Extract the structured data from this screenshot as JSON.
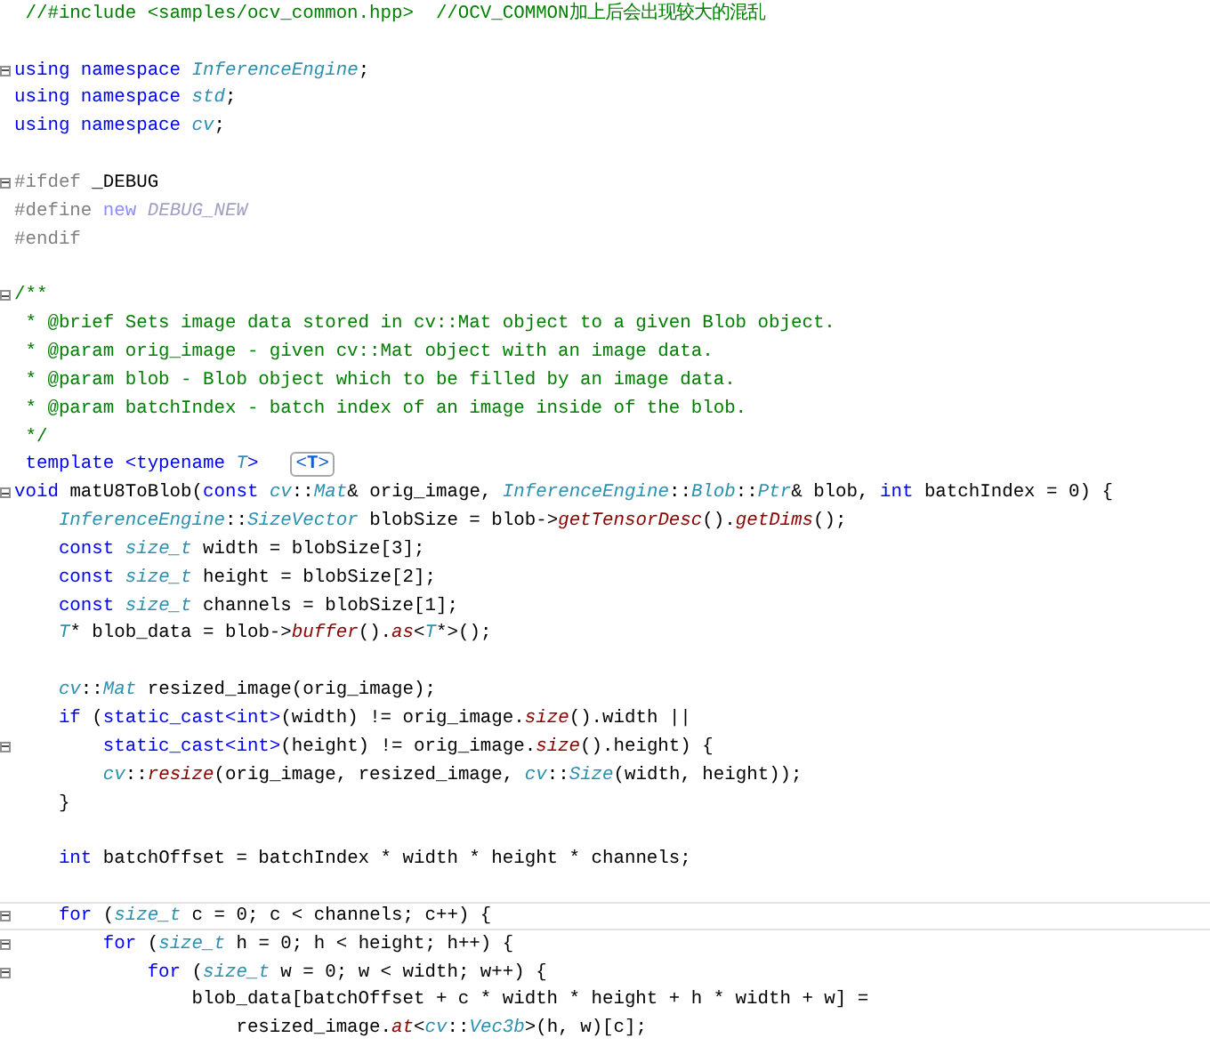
{
  "editor": {
    "lines": [
      {
        "fold": false,
        "current": false,
        "t": [
          {
            "kind": "c",
            "text": " //#include <samples/ocv_common.hpp>  //OCV_COMMON加上后会出现较大的混乱"
          }
        ]
      },
      {
        "fold": false,
        "current": false
      },
      {
        "fold": true,
        "current": false,
        "t": [
          {
            "kind": "kw",
            "text": "using namespace "
          },
          {
            "kind": "ty",
            "text": "InferenceEngine"
          },
          {
            "kind": "p",
            "text": ";"
          }
        ]
      },
      {
        "fold": false,
        "current": false,
        "t": [
          {
            "kind": "kw",
            "text": "using namespace "
          },
          {
            "kind": "ty",
            "text": "std"
          },
          {
            "kind": "p",
            "text": ";"
          }
        ]
      },
      {
        "fold": false,
        "current": false,
        "t": [
          {
            "kind": "kw",
            "text": "using namespace "
          },
          {
            "kind": "ty",
            "text": "cv"
          },
          {
            "kind": "p",
            "text": ";"
          }
        ]
      },
      {
        "fold": false,
        "current": false
      },
      {
        "fold": true,
        "current": false,
        "t": [
          {
            "kind": "pp",
            "text": "#ifdef"
          },
          {
            "kind": "p",
            "text": " _DEBUG"
          }
        ]
      },
      {
        "fold": false,
        "current": false,
        "t": [
          {
            "kind": "pp",
            "text": "#define "
          },
          {
            "kind": "pk",
            "text": "new "
          },
          {
            "kind": "pm",
            "text": "DEBUG_NEW"
          }
        ]
      },
      {
        "fold": false,
        "current": false,
        "t": [
          {
            "kind": "pp",
            "text": "#endif"
          }
        ]
      },
      {
        "fold": false,
        "current": false
      },
      {
        "fold": true,
        "current": false,
        "t": [
          {
            "kind": "c",
            "text": "/**"
          }
        ]
      },
      {
        "fold": false,
        "current": false,
        "t": [
          {
            "kind": "c",
            "text": " * @brief Sets image data stored in cv::Mat object to a given Blob object."
          }
        ]
      },
      {
        "fold": false,
        "current": false,
        "t": [
          {
            "kind": "c",
            "text": " * @param orig_image - given cv::Mat object with an image data."
          }
        ]
      },
      {
        "fold": false,
        "current": false,
        "t": [
          {
            "kind": "c",
            "text": " * @param blob - Blob object which to be filled by an image data."
          }
        ]
      },
      {
        "fold": false,
        "current": false,
        "t": [
          {
            "kind": "c",
            "text": " * @param batchIndex - batch index of an image inside of the blob."
          }
        ]
      },
      {
        "fold": false,
        "current": false,
        "t": [
          {
            "kind": "c",
            "text": " */"
          }
        ]
      },
      {
        "fold": false,
        "current": false,
        "t": [
          {
            "kind": "kw",
            "text": " template <typename "
          },
          {
            "kind": "ty",
            "text": "T"
          },
          {
            "kind": "kw",
            "text": ">"
          }
        ],
        "hint": "<**T**>"
      },
      {
        "fold": true,
        "current": false,
        "t": [
          {
            "kind": "kw",
            "text": "void"
          },
          {
            "kind": "p",
            "text": " matU8ToBlob("
          },
          {
            "kind": "kw",
            "text": "const "
          },
          {
            "kind": "ty",
            "text": "cv"
          },
          {
            "kind": "p",
            "text": "::"
          },
          {
            "kind": "ty",
            "text": "Mat"
          },
          {
            "kind": "p",
            "text": "& orig_image, "
          },
          {
            "kind": "ty",
            "text": "InferenceEngine"
          },
          {
            "kind": "p",
            "text": "::"
          },
          {
            "kind": "ty",
            "text": "Blob"
          },
          {
            "kind": "p",
            "text": "::"
          },
          {
            "kind": "ty",
            "text": "Ptr"
          },
          {
            "kind": "p",
            "text": "& blob, "
          },
          {
            "kind": "kw",
            "text": "int"
          },
          {
            "kind": "p",
            "text": " batchIndex = 0) {"
          }
        ]
      },
      {
        "fold": false,
        "current": false,
        "t": [
          {
            "kind": "ty",
            "text": "    InferenceEngine"
          },
          {
            "kind": "p",
            "text": "::"
          },
          {
            "kind": "ty",
            "text": "SizeVector"
          },
          {
            "kind": "p",
            "text": " blobSize = blob->"
          },
          {
            "kind": "fn",
            "text": "getTensorDesc"
          },
          {
            "kind": "p",
            "text": "()."
          },
          {
            "kind": "fn",
            "text": "getDims"
          },
          {
            "kind": "p",
            "text": "();"
          }
        ]
      },
      {
        "fold": false,
        "current": false,
        "t": [
          {
            "kind": "kw",
            "text": "    const "
          },
          {
            "kind": "ty",
            "text": "size_t"
          },
          {
            "kind": "p",
            "text": " width = blobSize[3];"
          }
        ]
      },
      {
        "fold": false,
        "current": false,
        "t": [
          {
            "kind": "kw",
            "text": "    const "
          },
          {
            "kind": "ty",
            "text": "size_t"
          },
          {
            "kind": "p",
            "text": " height = blobSize[2];"
          }
        ]
      },
      {
        "fold": false,
        "current": false,
        "t": [
          {
            "kind": "kw",
            "text": "    const "
          },
          {
            "kind": "ty",
            "text": "size_t"
          },
          {
            "kind": "p",
            "text": " channels = blobSize[1];"
          }
        ]
      },
      {
        "fold": false,
        "current": false,
        "t": [
          {
            "kind": "ty",
            "text": "    T"
          },
          {
            "kind": "p",
            "text": "* blob_data = blob->"
          },
          {
            "kind": "fn",
            "text": "buffer"
          },
          {
            "kind": "p",
            "text": "()."
          },
          {
            "kind": "fn",
            "text": "as"
          },
          {
            "kind": "p",
            "text": "<"
          },
          {
            "kind": "ty",
            "text": "T"
          },
          {
            "kind": "p",
            "text": "*>();"
          }
        ]
      },
      {
        "fold": false,
        "current": false
      },
      {
        "fold": false,
        "current": false,
        "t": [
          {
            "kind": "ty",
            "text": "    cv"
          },
          {
            "kind": "p",
            "text": "::"
          },
          {
            "kind": "ty",
            "text": "Mat"
          },
          {
            "kind": "p",
            "text": " resized_image(orig_image);"
          }
        ]
      },
      {
        "fold": false,
        "current": false,
        "t": [
          {
            "kind": "kw",
            "text": "    if"
          },
          {
            "kind": "p",
            "text": " ("
          },
          {
            "kind": "kw",
            "text": "static_cast<int>"
          },
          {
            "kind": "p",
            "text": "(width) != orig_image."
          },
          {
            "kind": "fn",
            "text": "size"
          },
          {
            "kind": "p",
            "text": "().width ||"
          }
        ]
      },
      {
        "fold": true,
        "current": false,
        "t": [
          {
            "kind": "kw",
            "text": "        static_cast<int>"
          },
          {
            "kind": "p",
            "text": "(height) != orig_image."
          },
          {
            "kind": "fn",
            "text": "size"
          },
          {
            "kind": "p",
            "text": "().height) {"
          }
        ]
      },
      {
        "fold": false,
        "current": false,
        "t": [
          {
            "kind": "ty",
            "text": "        cv"
          },
          {
            "kind": "p",
            "text": "::"
          },
          {
            "kind": "fn",
            "text": "resize"
          },
          {
            "kind": "p",
            "text": "(orig_image, resized_image, "
          },
          {
            "kind": "ty",
            "text": "cv"
          },
          {
            "kind": "p",
            "text": "::"
          },
          {
            "kind": "ty",
            "text": "Size"
          },
          {
            "kind": "p",
            "text": "(width, height));"
          }
        ]
      },
      {
        "fold": false,
        "current": false,
        "t": [
          {
            "kind": "p",
            "text": "    }"
          }
        ]
      },
      {
        "fold": false,
        "current": false
      },
      {
        "fold": false,
        "current": false,
        "t": [
          {
            "kind": "kw",
            "text": "    int"
          },
          {
            "kind": "p",
            "text": " batchOffset = batchIndex * width * height * channels;"
          }
        ]
      },
      {
        "fold": false,
        "current": false
      },
      {
        "fold": true,
        "current": true,
        "t": [
          {
            "kind": "kw",
            "text": "    for"
          },
          {
            "kind": "p",
            "text": " ("
          },
          {
            "kind": "ty",
            "text": "size_t"
          },
          {
            "kind": "p",
            "text": " c = 0; c < channels; c++) {"
          }
        ]
      },
      {
        "fold": true,
        "current": false,
        "t": [
          {
            "kind": "kw",
            "text": "        for"
          },
          {
            "kind": "p",
            "text": " ("
          },
          {
            "kind": "ty",
            "text": "size_t"
          },
          {
            "kind": "p",
            "text": " h = 0; h < height; h++) {"
          }
        ]
      },
      {
        "fold": true,
        "current": false,
        "t": [
          {
            "kind": "kw",
            "text": "            for"
          },
          {
            "kind": "p",
            "text": " ("
          },
          {
            "kind": "ty",
            "text": "size_t"
          },
          {
            "kind": "p",
            "text": " w = 0; w < width; w++) {"
          }
        ]
      },
      {
        "fold": false,
        "current": false,
        "t": [
          {
            "kind": "p",
            "text": "                blob_data[batchOffset + c * width * height + h * width + w] ="
          }
        ]
      },
      {
        "fold": false,
        "current": false,
        "t": [
          {
            "kind": "p",
            "text": "                    resized_image."
          },
          {
            "kind": "fn",
            "text": "at"
          },
          {
            "kind": "p",
            "text": "<"
          },
          {
            "kind": "ty",
            "text": "cv"
          },
          {
            "kind": "p",
            "text": "::"
          },
          {
            "kind": "ty",
            "text": "Vec3b"
          },
          {
            "kind": "p",
            "text": ">(h, w)[c];"
          }
        ]
      }
    ]
  }
}
